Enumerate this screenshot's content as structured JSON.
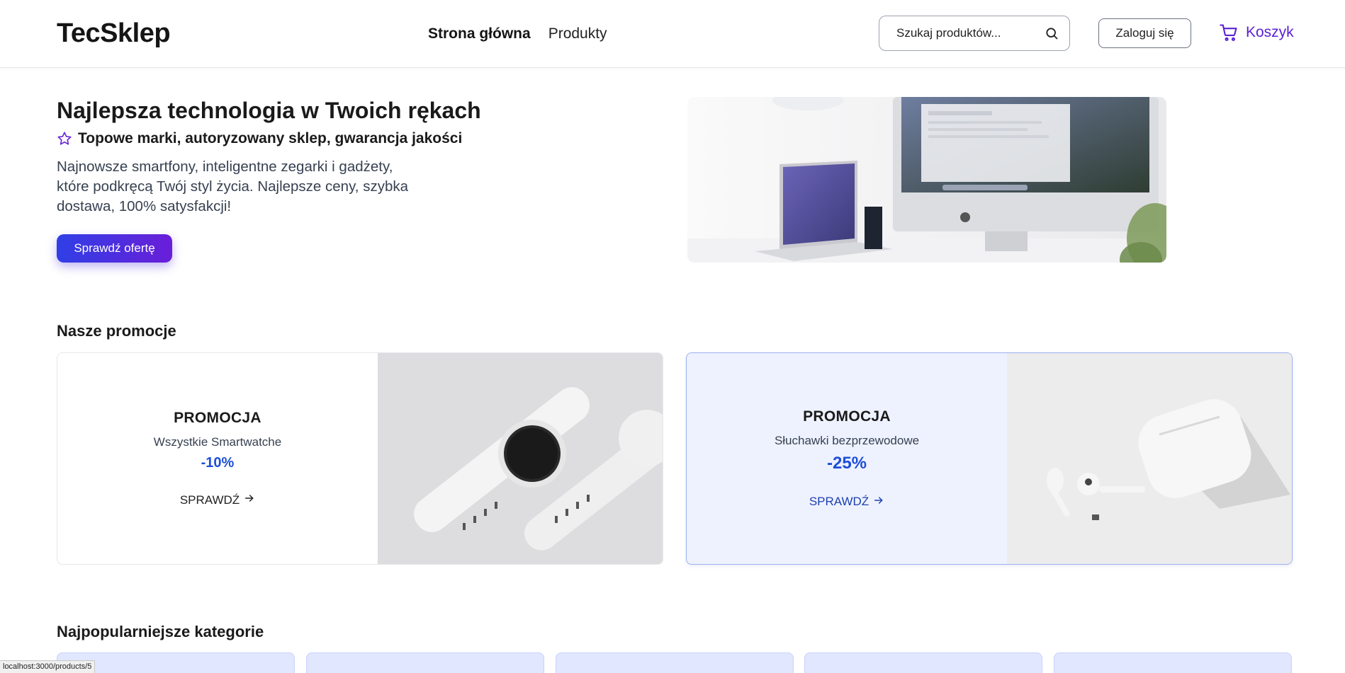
{
  "header": {
    "logo": "TecSklep",
    "nav": [
      {
        "label": "Strona główna",
        "active": true
      },
      {
        "label": "Produkty",
        "active": false
      }
    ],
    "search": {
      "placeholder": "Szukaj produktów...",
      "value": ""
    },
    "login_label": "Zaloguj się",
    "cart_label": "Koszyk"
  },
  "hero": {
    "title": "Najlepsza technologia w Twoich rękach",
    "subtitle": "Topowe marki, autoryzowany sklep, gwarancja jakości",
    "description": "Najnowsze smartfony, inteligentne zegarki i gadżety, które podkręcą Twój styl życia. Najlepsze ceny, szybka dostawa, 100% satysfakcji!",
    "cta_label": "Sprawdź ofertę"
  },
  "promotions": {
    "title": "Nasze promocje",
    "items": [
      {
        "title": "PROMOCJA",
        "description": "Wszystkie Smartwatche",
        "discount": "-10%",
        "link_label": "SPRAWDŹ"
      },
      {
        "title": "PROMOCJA",
        "description": "Słuchawki bezprzewodowe",
        "discount": "-25%",
        "link_label": "SPRAWDŹ"
      }
    ]
  },
  "categories": {
    "title": "Najpopularniejsze kategorie"
  },
  "status_bar": {
    "url": "localhost:3000/products/5"
  },
  "colors": {
    "accent": "#5b21d6",
    "discount": "#1d4ed8",
    "button_gradient_start": "#2f3fe6",
    "button_gradient_end": "#6a1ed8"
  },
  "icons": {
    "search": "search-icon",
    "cart": "cart-icon",
    "star": "star-icon",
    "arrow": "arrow-right-icon"
  }
}
